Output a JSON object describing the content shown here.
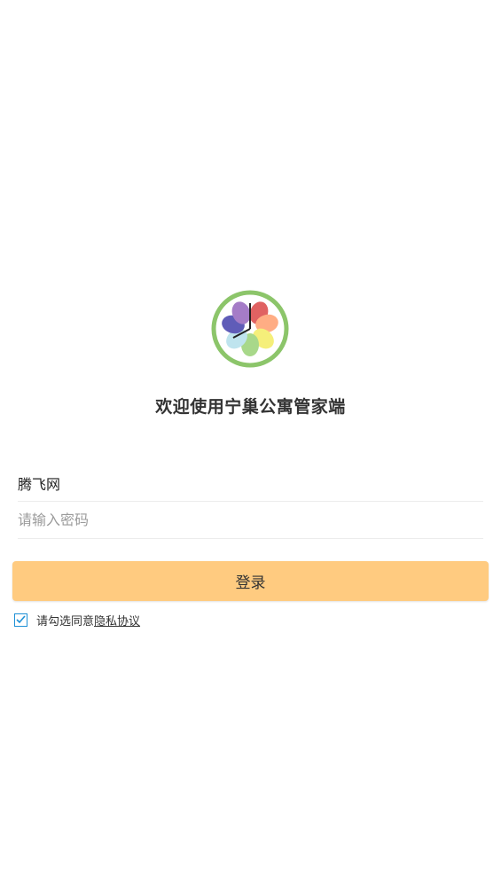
{
  "app": {
    "welcome_text": "欢迎使用宁巢公寓管家端"
  },
  "form": {
    "username_value": "腾飞网",
    "password_value": "",
    "password_placeholder": "请输入密码",
    "login_label": "登录"
  },
  "agreement": {
    "checked": true,
    "prefix": "请勾选同意",
    "link_text": "隐私协议"
  },
  "colors": {
    "login_button": "#ffcb80",
    "checkbox": "#1e90d6",
    "logo_ring": "#8cc56a"
  },
  "icons": {
    "logo": "flower-clock-logo",
    "checkbox": "checkmark-icon"
  }
}
